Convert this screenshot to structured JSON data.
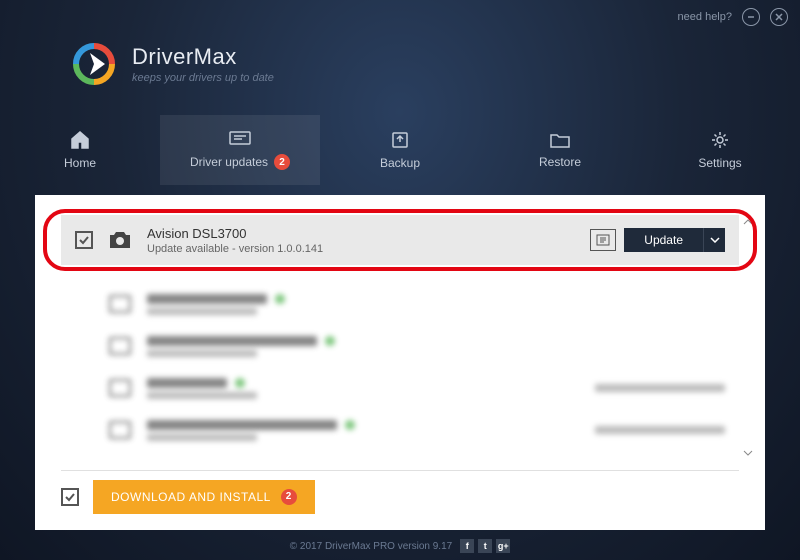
{
  "topbar": {
    "help": "need help?"
  },
  "brand": {
    "title": "DriverMax",
    "tagline": "keeps your drivers up to date"
  },
  "nav": {
    "home": "Home",
    "updates": "Driver updates",
    "updates_badge": "2",
    "backup": "Backup",
    "restore": "Restore",
    "settings": "Settings"
  },
  "device": {
    "name": "Avision DSL3700",
    "status": "Update available - version 1.0.0.141",
    "update_label": "Update"
  },
  "blurred": [
    {
      "name_w": 120,
      "sub": true,
      "right": false
    },
    {
      "name_w": 170,
      "sub": true,
      "right": false
    },
    {
      "name_w": 80,
      "sub": true,
      "right": true
    },
    {
      "name_w": 190,
      "sub": true,
      "right": true
    }
  ],
  "footer": {
    "download_label": "DOWNLOAD AND INSTALL",
    "download_badge": "2"
  },
  "copyright": {
    "text": "© 2017 DriverMax PRO version 9.17"
  }
}
